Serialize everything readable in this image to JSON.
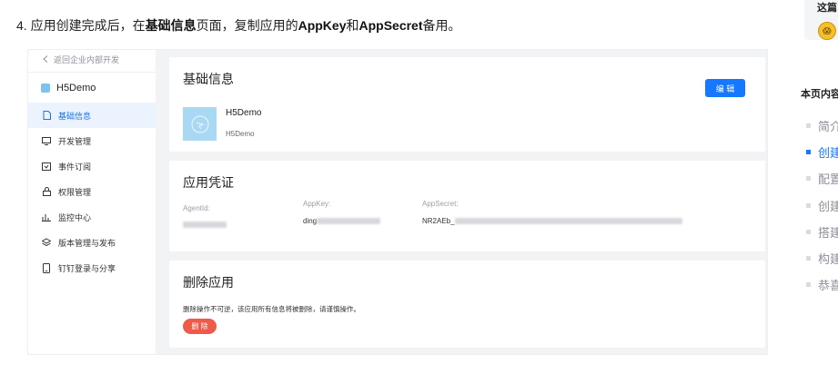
{
  "step": {
    "prefix": "4. 应用创建完成后，在",
    "bold1": "基础信息",
    "mid": "页面，复制应用的",
    "bold2": "AppKey",
    "and": "和",
    "bold3": "AppSecret",
    "suffix": "备用。"
  },
  "sidebar": {
    "back": "返回企业内部开发",
    "app_name": "H5Demo",
    "items": [
      {
        "label": "基础信息",
        "icon": "document-icon"
      },
      {
        "label": "开发管理",
        "icon": "monitor-icon"
      },
      {
        "label": "事件订阅",
        "icon": "calendar-icon"
      },
      {
        "label": "权限管理",
        "icon": "lock-icon"
      },
      {
        "label": "监控中心",
        "icon": "bar-chart-icon"
      },
      {
        "label": "版本管理与发布",
        "icon": "layers-icon"
      },
      {
        "label": "钉钉登录与分享",
        "icon": "phone-icon"
      }
    ]
  },
  "basic_info": {
    "title": "基础信息",
    "edit_label": "编 辑",
    "app_name": "H5Demo",
    "app_name_sub": "H5Demo"
  },
  "credentials": {
    "title": "应用凭证",
    "agentid_label": "AgentId:",
    "appkey_label": "AppKey:",
    "appkey_prefix": "ding",
    "appsecret_label": "AppSecret:",
    "appsecret_prefix": "NR2AEb_"
  },
  "delete_app": {
    "title": "删除应用",
    "desc": "删除操作不可逆，该应用所有信息将被删除，请谨慎操作。",
    "button": "删 除"
  },
  "toc": {
    "top_text": "这篇",
    "emoji": "😱",
    "title": "本页内容",
    "items": [
      "简介",
      "创建",
      "配置",
      "创建",
      "搭建",
      "构建",
      "恭喜"
    ],
    "active_index": 1
  },
  "colors": {
    "primary": "#1677ff",
    "danger": "#f05a4a",
    "app_icon": "#a9d8f5"
  }
}
